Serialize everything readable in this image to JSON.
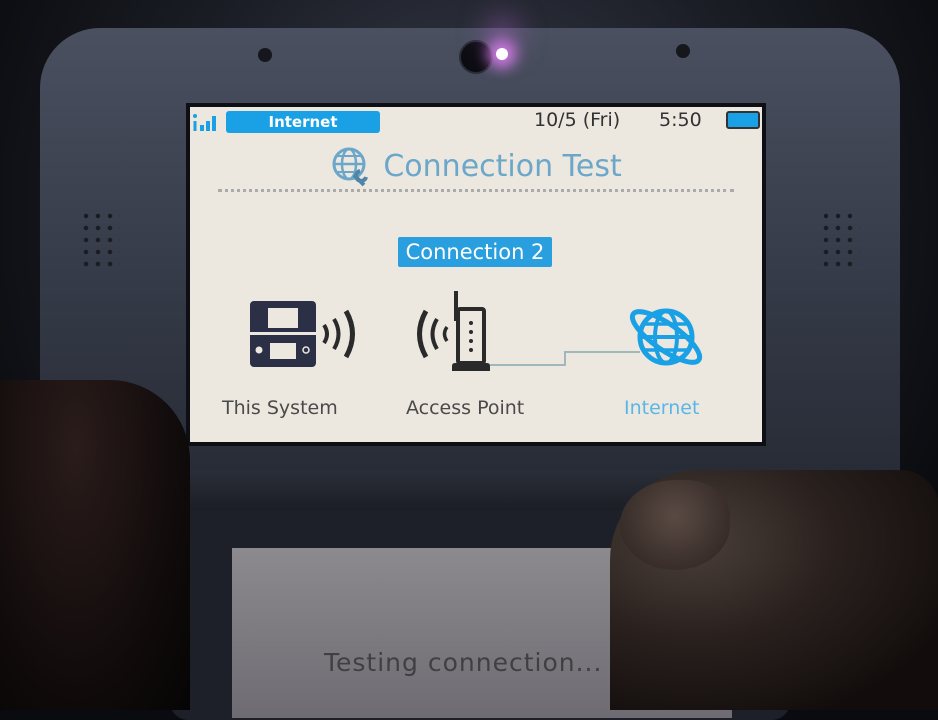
{
  "top_screen": {
    "status_bar": {
      "signal_icon": "wifi-signal-icon",
      "connection_label": "Internet",
      "date": "10/5 (Fri)",
      "time": "5:50",
      "battery_icon": "battery-icon"
    },
    "title": "Connection Test",
    "title_icon": "globe-wrench-icon",
    "connection_badge": "Connection 2",
    "nodes": [
      {
        "label": "This System",
        "icon": "3ds-console-icon"
      },
      {
        "label": "Access Point",
        "icon": "router-icon"
      },
      {
        "label": "Internet",
        "icon": "globe-icon"
      }
    ],
    "colors": {
      "accent": "#1aa0e4",
      "title": "#6ca7c9",
      "background": "#ece8e0"
    }
  },
  "bottom_screen": {
    "status_text": "Testing connection..."
  }
}
